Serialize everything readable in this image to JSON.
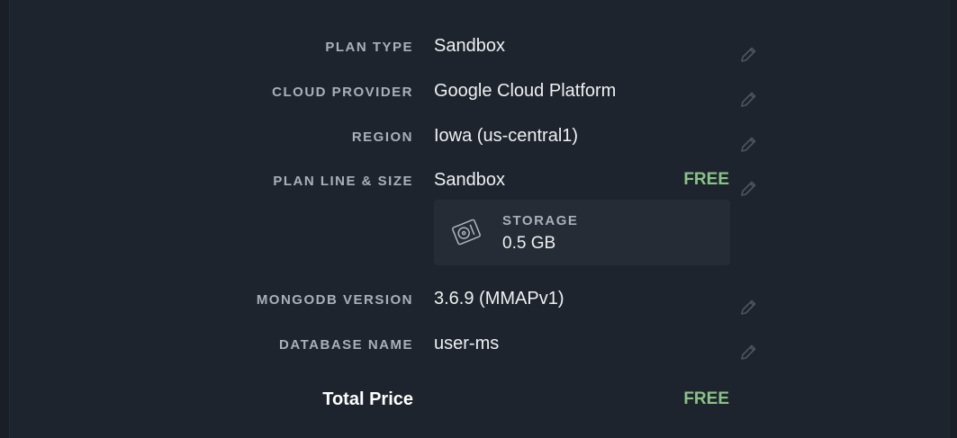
{
  "rows": [
    {
      "label": "PLAN TYPE",
      "value": "Sandbox"
    },
    {
      "label": "CLOUD PROVIDER",
      "value": "Google Cloud Platform"
    },
    {
      "label": "REGION",
      "value": "Iowa (us-central1)"
    },
    {
      "label": "PLAN LINE & SIZE",
      "value": "Sandbox",
      "price": "FREE"
    },
    {
      "label": "MONGODB VERSION",
      "value": "3.6.9 (MMAPv1)"
    },
    {
      "label": "DATABASE NAME",
      "value": "user-ms"
    }
  ],
  "storage": {
    "label": "STORAGE",
    "value": "0.5 GB",
    "icon": "hard-drive-icon"
  },
  "total": {
    "label": "Total Price",
    "value": "FREE"
  },
  "colors": {
    "background": "#1e242d",
    "label": "#a8b0b9",
    "value": "#eef0f2",
    "free": "#8bc288",
    "edit_icon": "#4a5563",
    "storage_card": "#262c35"
  }
}
